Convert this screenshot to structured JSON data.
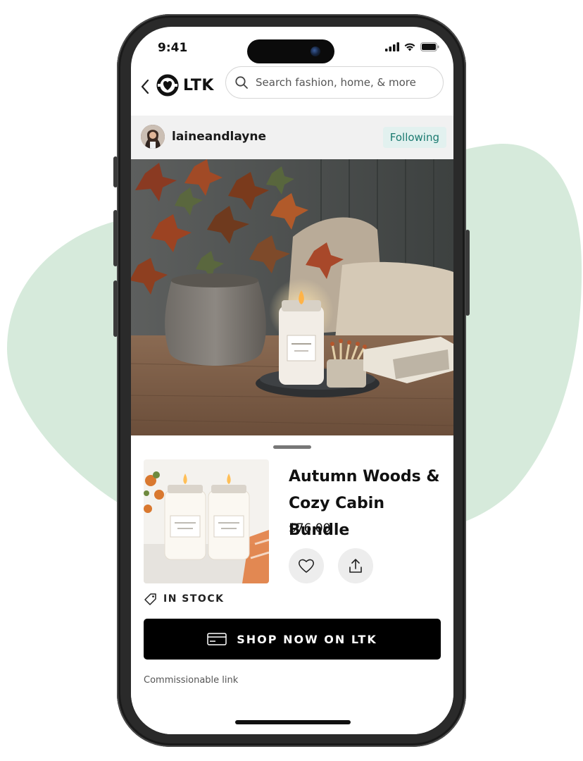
{
  "colors": {
    "blob": "#d6eadb",
    "phone_frame": "#2a2a2a",
    "accent_teal": "#1a7a70",
    "following_bg": "#e2f1ef",
    "shop_button": "#000000"
  },
  "status_bar": {
    "time": "9:41",
    "icons": [
      "signal-icon",
      "wifi-icon",
      "battery-icon"
    ]
  },
  "nav": {
    "back_icon": "chevron-left-icon",
    "logo_text": "LTK",
    "search_placeholder": "Search fashion, home, & more"
  },
  "creator": {
    "name": "laineandlayne",
    "follow_status": "Following"
  },
  "product": {
    "title": "Autumn Woods & Cozy Cabin Bundle",
    "price": "$76.00",
    "stock_status": "IN STOCK",
    "cta_label": "SHOP NOW ON LTK",
    "disclosure": "Commissionable link"
  }
}
